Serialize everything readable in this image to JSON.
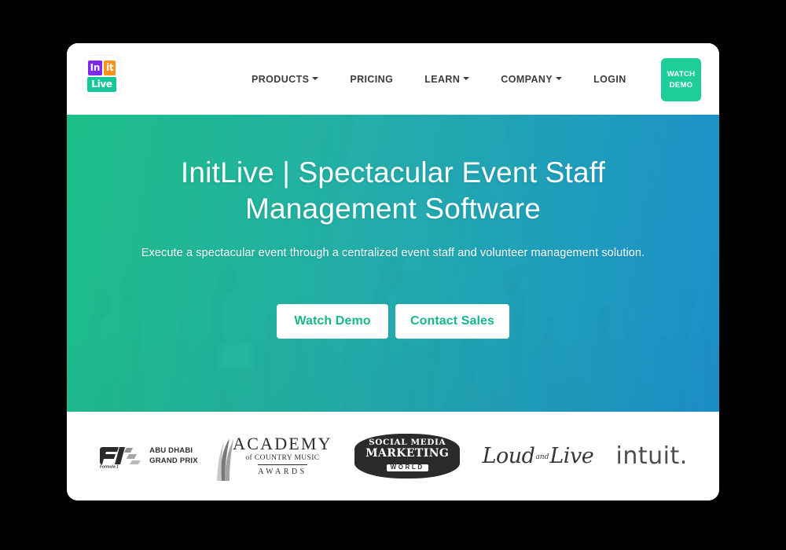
{
  "brand": {
    "logo_parts": [
      {
        "text": "In",
        "color": "#7d2ae8"
      },
      {
        "text": "it",
        "color": "#f7941e"
      },
      {
        "text": "Live",
        "color": "#16c79a"
      }
    ]
  },
  "nav": {
    "items": [
      {
        "label": "PRODUCTS",
        "has_dropdown": true
      },
      {
        "label": "PRICING",
        "has_dropdown": false
      },
      {
        "label": "LEARN",
        "has_dropdown": true
      },
      {
        "label": "COMPANY",
        "has_dropdown": true
      },
      {
        "label": "LOGIN",
        "has_dropdown": false
      }
    ],
    "cta": {
      "line1": "WATCH",
      "line2": "DEMO",
      "color": "#1ecd97"
    }
  },
  "hero": {
    "title": "InitLive | Spectacular Event Staff Management Software",
    "subtitle": "Execute a spectacular event through a centralized event staff and volunteer management solution.",
    "buttons": [
      {
        "label": "Watch Demo"
      },
      {
        "label": "Contact Sales"
      }
    ],
    "gradient_start": "#1fc48c",
    "gradient_end": "#1d93d1",
    "button_text_color": "#15b886"
  },
  "clients": [
    {
      "name": "abu-dhabi-grand-prix",
      "mark": "F1",
      "mark_sub": "Formula 1",
      "line1": "ABU DHABI",
      "line2": "GRAND PRIX"
    },
    {
      "name": "academy-of-country-music-awards",
      "line1": "ACADEMY",
      "line2": "of COUNTRY MUSIC",
      "line3": "AWARDS"
    },
    {
      "name": "social-media-marketing-world",
      "line1": "SOCIAL MEDIA",
      "line2": "MARKETING",
      "line3": "WORLD"
    },
    {
      "name": "loud-and-live",
      "word1": "Loud",
      "word2": "and",
      "word3": "Live"
    },
    {
      "name": "intuit",
      "wordmark": "intuit."
    }
  ]
}
